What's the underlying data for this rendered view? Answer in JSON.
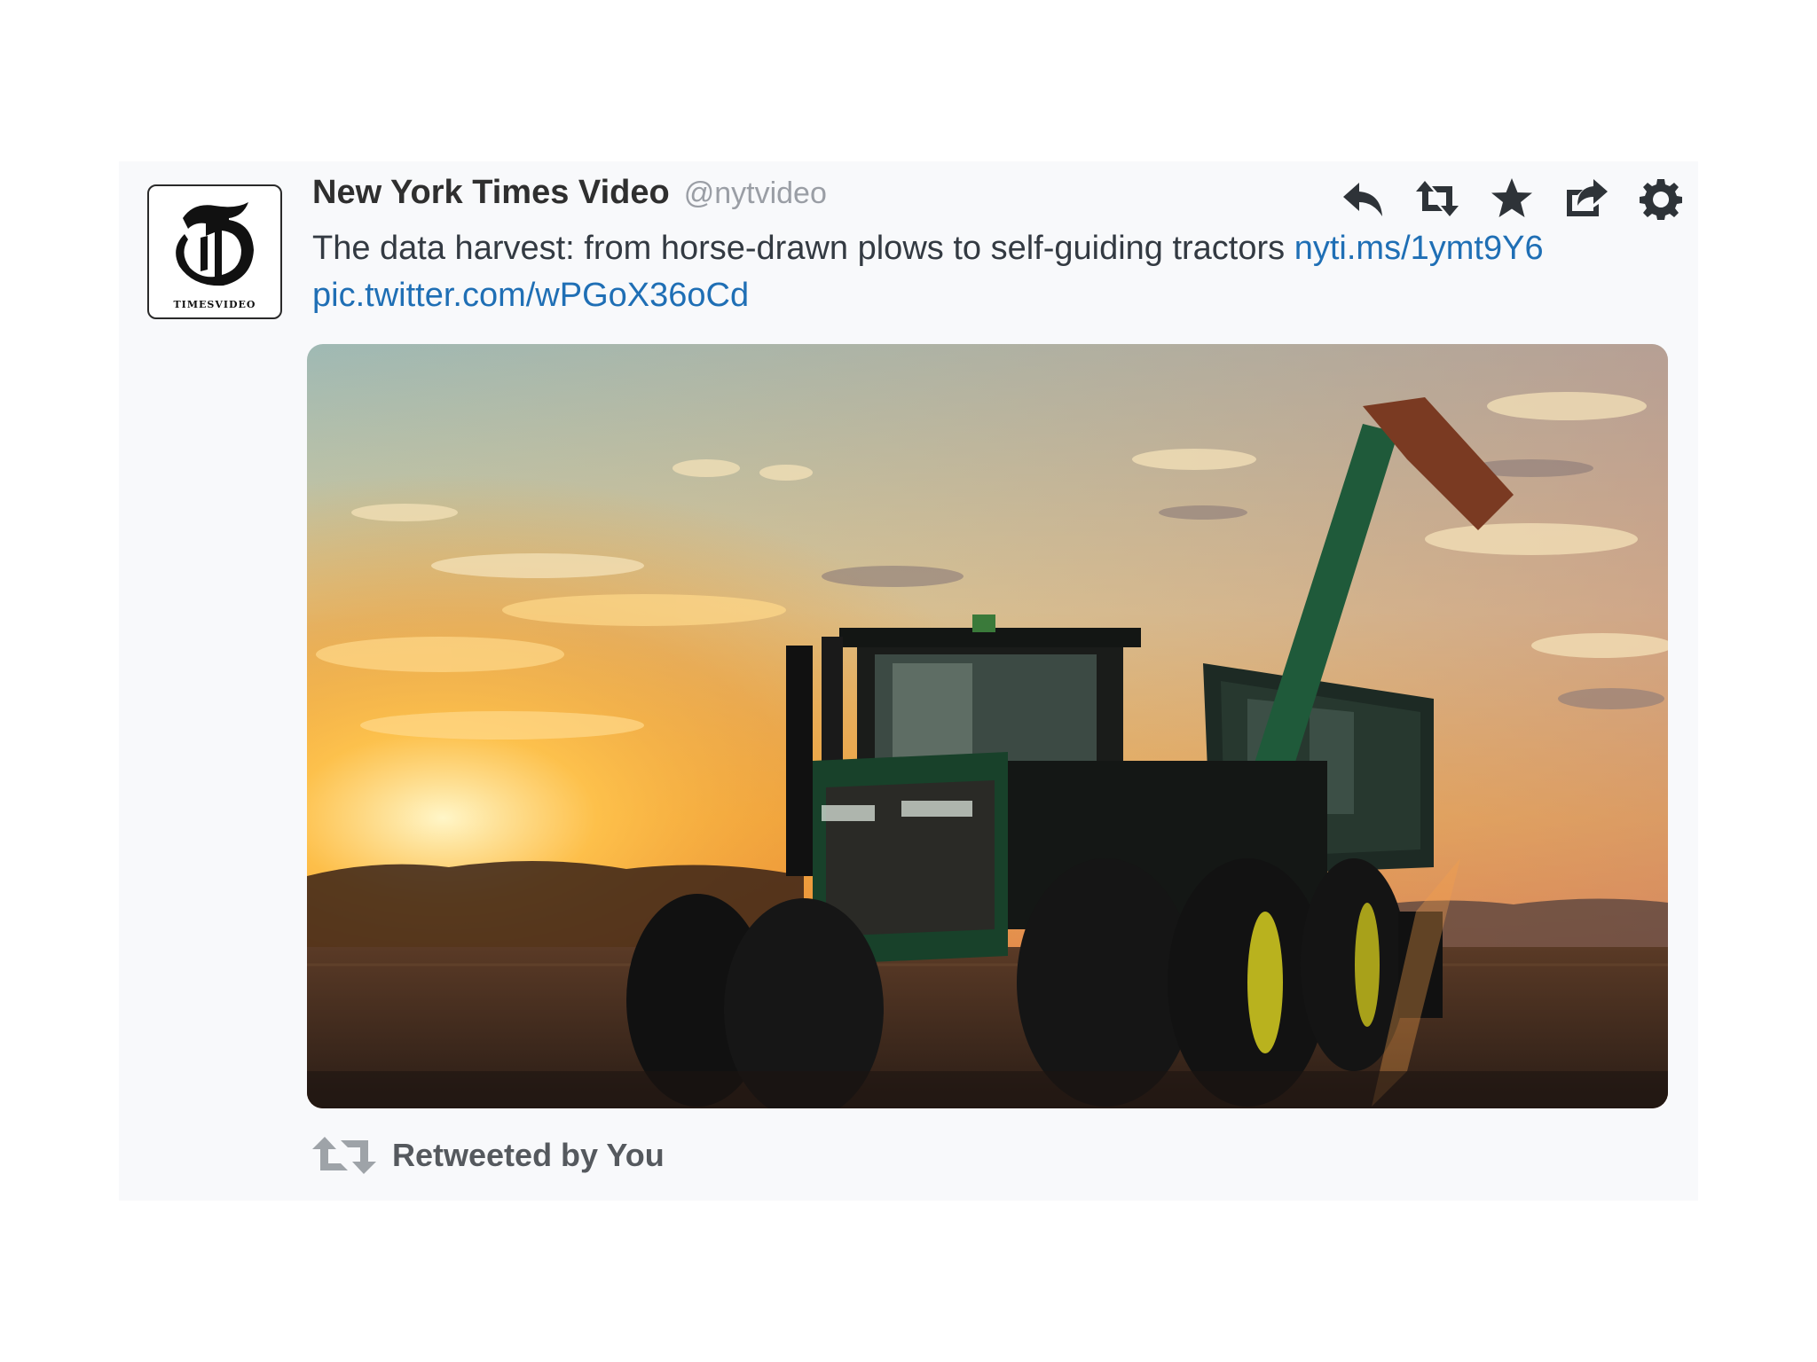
{
  "tweet": {
    "author": {
      "display_name": "New York Times Video",
      "handle": "@nytvideo",
      "avatar_icon": "nyt-logo-icon",
      "avatar_caption": "TIMESVIDEO"
    },
    "text": "The data harvest: from horse-drawn plows to self-guiding tractors",
    "links": [
      {
        "text": "nyti.ms/1ymt9Y6"
      },
      {
        "text": "pic.twitter.com/wPGoX36oCd"
      }
    ],
    "actions": [
      {
        "name": "reply",
        "icon": "reply-icon"
      },
      {
        "name": "retweet",
        "icon": "retweet-icon"
      },
      {
        "name": "favorite",
        "icon": "star-icon"
      },
      {
        "name": "share",
        "icon": "share-icon"
      },
      {
        "name": "more",
        "icon": "gear-icon"
      }
    ],
    "media": {
      "kind": "photo",
      "subject": "green tractor with grain cart at sunset in a harvested field"
    },
    "retweet_context": {
      "label": "Retweeted by You",
      "icon": "retweet-icon"
    }
  },
  "colors": {
    "card_background": "#f8f9fb",
    "link": "#1f6fb5",
    "name": "#2f2f2f",
    "handle": "#9a9ea5",
    "icon": "#2e3338",
    "muted_icon": "#9ea3a8"
  }
}
